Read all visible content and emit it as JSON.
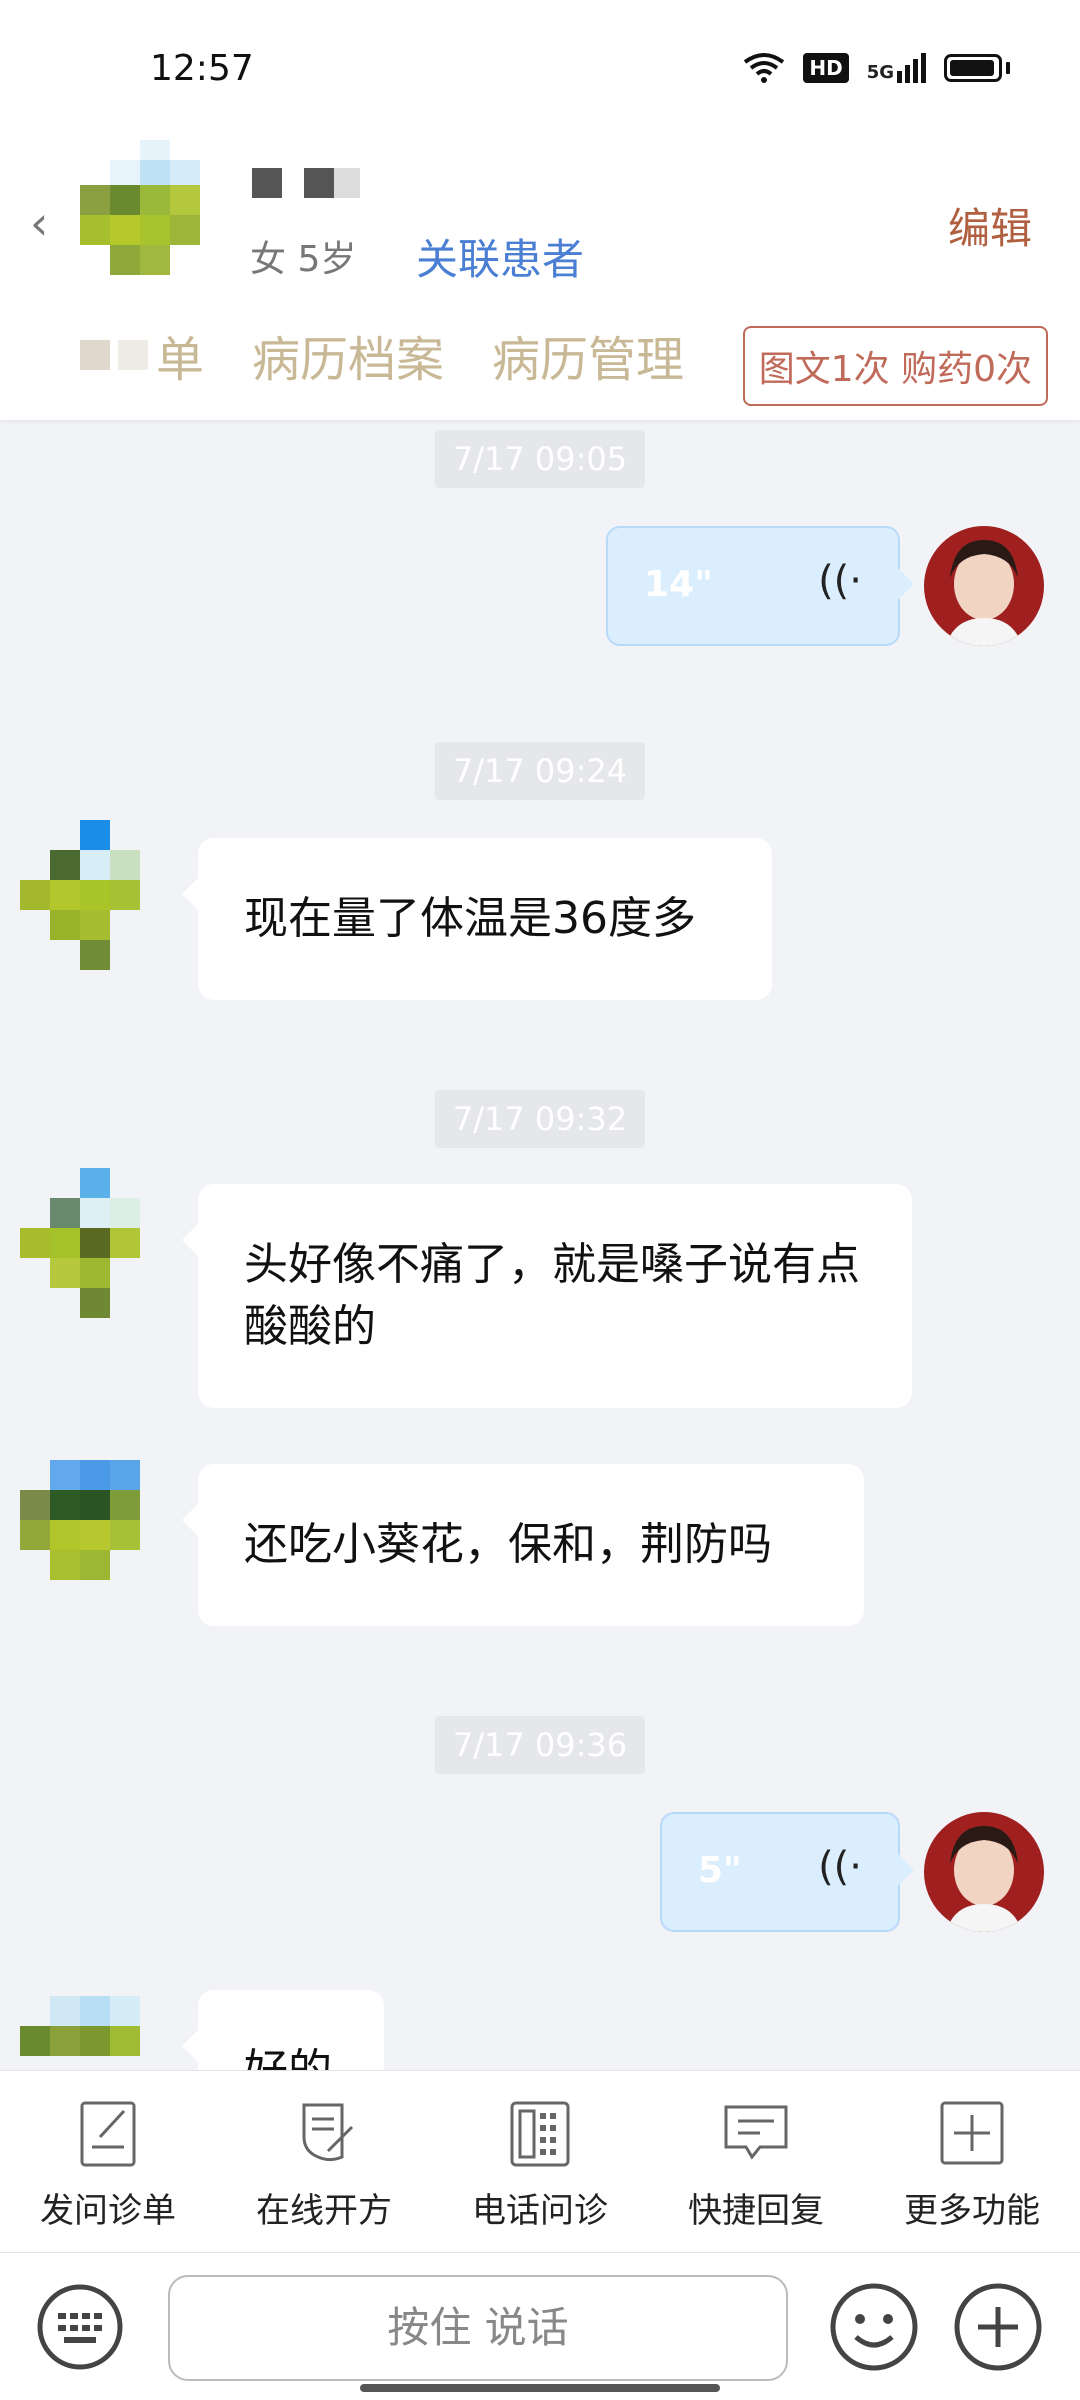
{
  "status": {
    "time": "12:57",
    "hd": "HD",
    "net": "5G"
  },
  "header": {
    "patient_meta": "女 5岁",
    "link_patient": "关联患者",
    "edit": "编辑",
    "tabs": [
      "单",
      "病历档案",
      "病历管理"
    ],
    "badge": "图文1次 购药0次"
  },
  "chat": {
    "messages": [
      {
        "time": "7/17 09:05",
        "from": "doctor",
        "type": "voice",
        "duration": "14\""
      },
      {
        "time": "7/17 09:24",
        "from": "patient",
        "type": "text",
        "text": "现在量了体温是36度多"
      },
      {
        "time": "7/17 09:32",
        "from": "patient",
        "type": "text",
        "text": "头好像不痛了，就是嗓子说有点酸酸的"
      },
      {
        "time": "",
        "from": "patient",
        "type": "text",
        "text": "还吃小葵花，保和，荆防吗"
      },
      {
        "time": "7/17 09:36",
        "from": "doctor",
        "type": "voice",
        "duration": "5\""
      },
      {
        "time": "",
        "from": "patient",
        "type": "text",
        "text": "好的"
      }
    ]
  },
  "functions": [
    {
      "label": "发问诊单",
      "icon": "form-icon"
    },
    {
      "label": "在线开方",
      "icon": "prescription-icon"
    },
    {
      "label": "电话问诊",
      "icon": "phone-icon"
    },
    {
      "label": "快捷回复",
      "icon": "quick-reply-icon"
    },
    {
      "label": "更多功能",
      "icon": "more-icon"
    }
  ],
  "input": {
    "hold_talk": "按住 说话"
  }
}
